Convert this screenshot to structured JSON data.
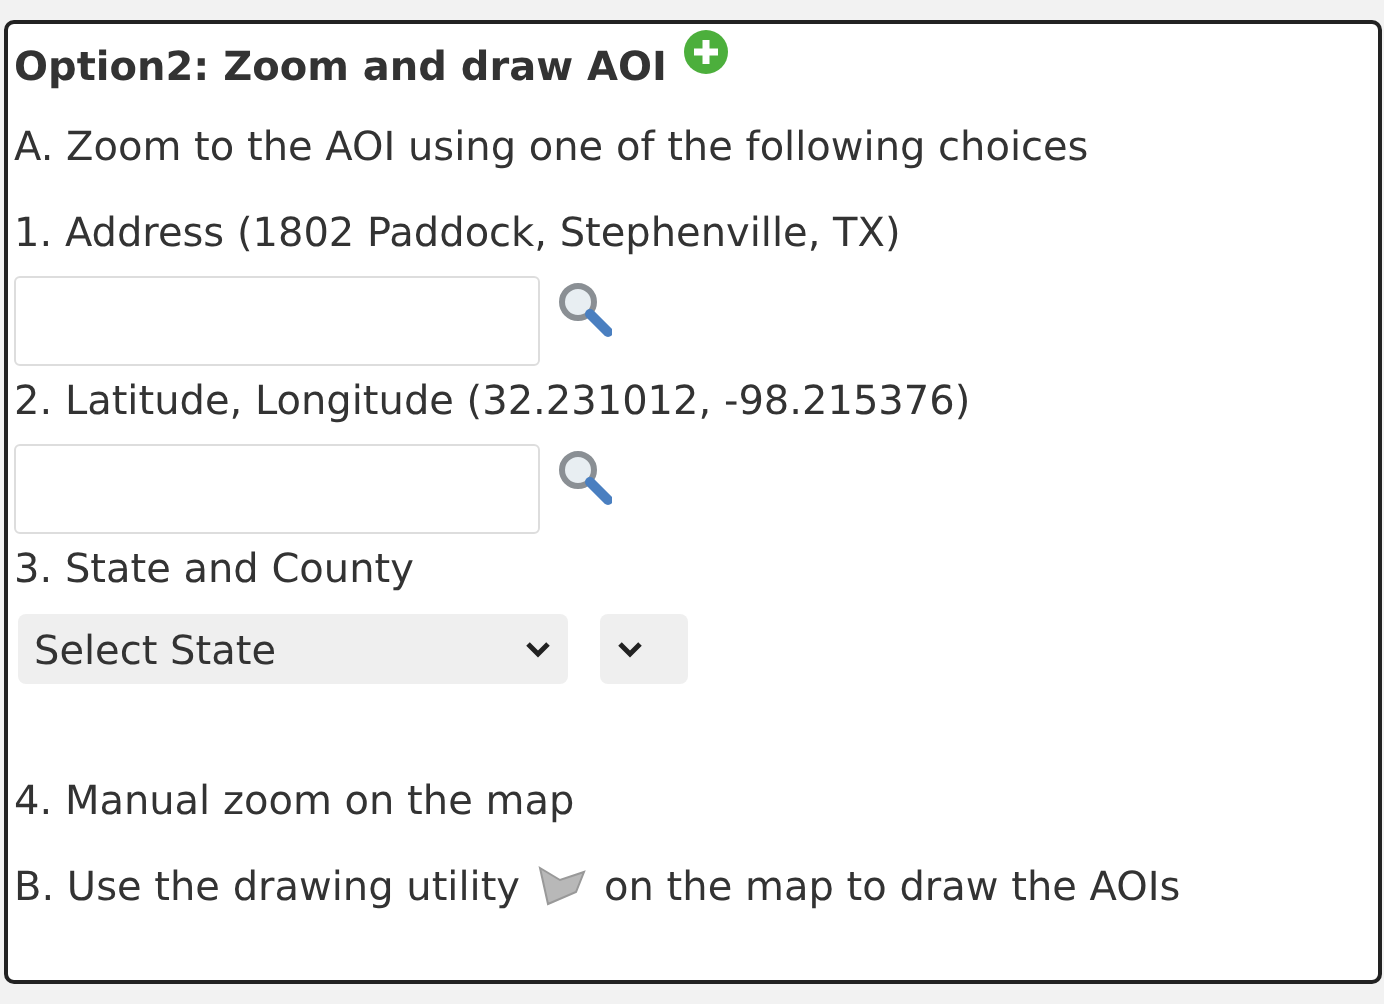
{
  "heading": "Option2: Zoom and draw AOI",
  "intro": "A. Zoom to the AOI using one of the following choices",
  "choices": [
    {
      "kind": "search",
      "label": "1. Address (1802 Paddock, Stephenville, TX)"
    },
    {
      "kind": "search",
      "label": "2. Latitude, Longitude (32.231012, -98.215376)"
    },
    {
      "kind": "selects",
      "label": "3. State and County",
      "state_select": "Select State"
    },
    {
      "kind": "text",
      "label": "4. Manual zoom on the map"
    }
  ],
  "instruction": {
    "before": "B. Use the drawing utility",
    "after": "on the map to draw the AOIs"
  }
}
